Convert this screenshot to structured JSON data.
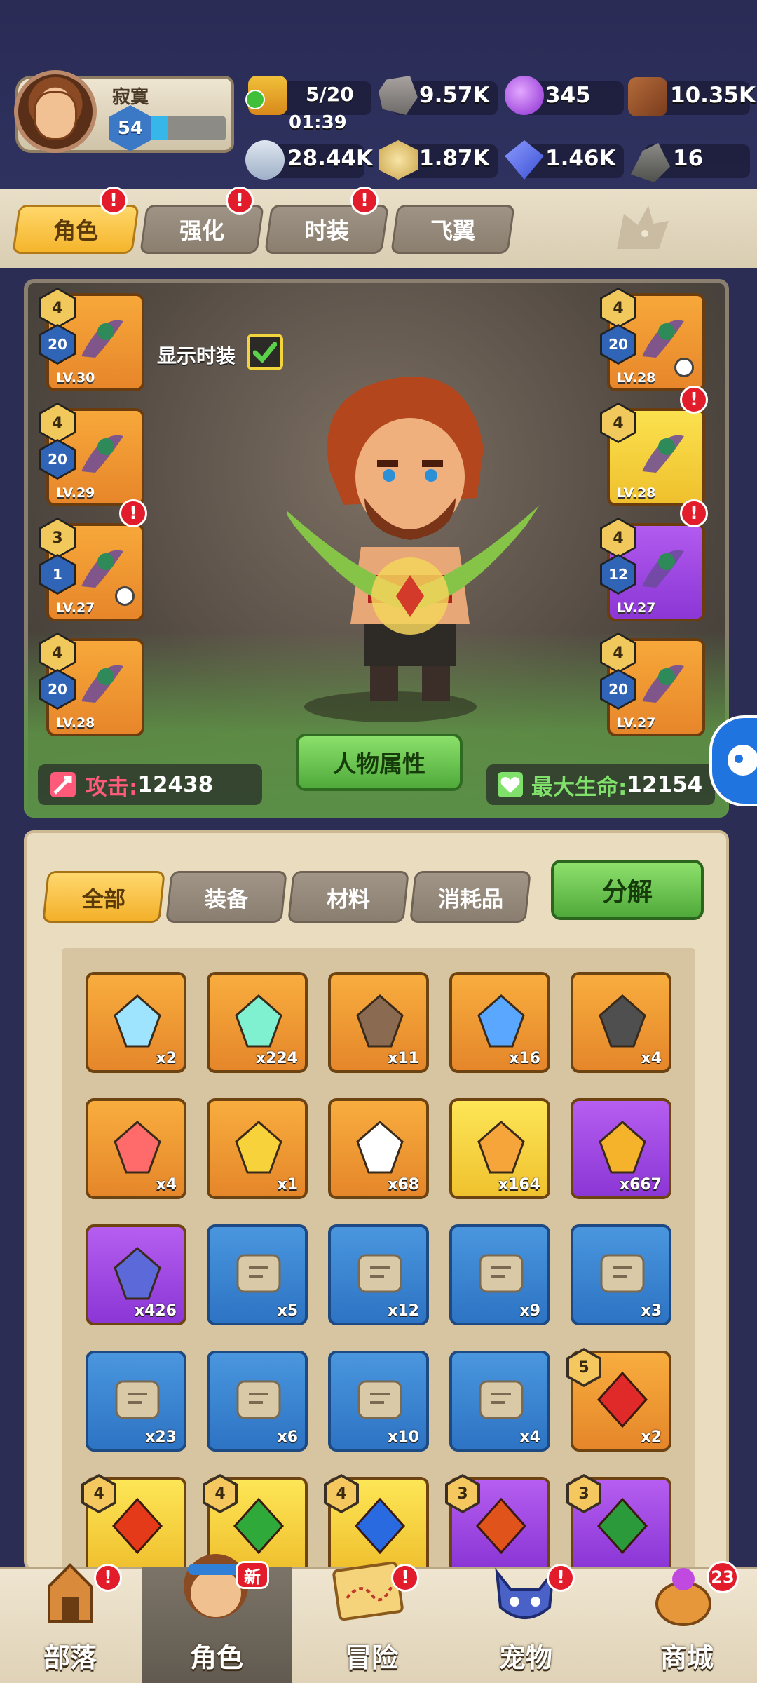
{
  "player": {
    "name": "寂寞",
    "level": "54",
    "xp_fraction": 0.26
  },
  "resources": {
    "stamina": "5/20",
    "stamina_timer": "01:39",
    "stone": "9.57K",
    "orb": "345",
    "wood": "10.35K",
    "bone": "28.44K",
    "coin": "1.87K",
    "crystal": "1.46K",
    "ore": "16"
  },
  "tabs": [
    "角色",
    "强化",
    "时装",
    "飞翼"
  ],
  "panel": {
    "show_fashion": "显示时装",
    "attack_label": "攻击:",
    "attack_value": "12438",
    "attr_button": "人物属性",
    "hp_label": "最大生命:",
    "hp_value": "12154"
  },
  "equip_left": [
    {
      "star": "4",
      "quality": "20",
      "lv": "LV.30"
    },
    {
      "star": "4",
      "quality": "20",
      "lv": "LV.29"
    },
    {
      "star": "3",
      "quality": "1",
      "lv": "LV.27"
    },
    {
      "star": "4",
      "quality": "20",
      "lv": "LV.28"
    }
  ],
  "equip_right": [
    {
      "star": "4",
      "quality": "20",
      "lv": "LV.28"
    },
    {
      "star": "4",
      "quality": "",
      "lv": "LV.28"
    },
    {
      "star": "4",
      "quality": "12",
      "lv": "LV.27"
    },
    {
      "star": "4",
      "quality": "20",
      "lv": "LV.27"
    }
  ],
  "filters": [
    "全部",
    "装备",
    "材料",
    "消耗品"
  ],
  "decompose": "分解",
  "items": [
    {
      "qty": "x2"
    },
    {
      "qty": "x224"
    },
    {
      "qty": "x11"
    },
    {
      "qty": "x16"
    },
    {
      "qty": "x4"
    },
    {
      "qty": "x4"
    },
    {
      "qty": "x1"
    },
    {
      "qty": "x68"
    },
    {
      "qty": "x164"
    },
    {
      "qty": "x667"
    },
    {
      "qty": "x426"
    },
    {
      "qty": "x5"
    },
    {
      "qty": "x12"
    },
    {
      "qty": "x9"
    },
    {
      "qty": "x3"
    },
    {
      "qty": "x23"
    },
    {
      "qty": "x6"
    },
    {
      "qty": "x10"
    },
    {
      "qty": "x4"
    },
    {
      "qty": "x2",
      "star": "5"
    },
    {
      "qty": "",
      "star": "4"
    },
    {
      "qty": "",
      "star": "4"
    },
    {
      "qty": "",
      "star": "4"
    },
    {
      "qty": "",
      "star": "3"
    },
    {
      "qty": "",
      "star": "3"
    }
  ],
  "nav": {
    "tribe": "部落",
    "character": "角色",
    "adventure": "冒险",
    "pet": "宠物",
    "shop": "商城",
    "new_badge": "新",
    "shop_count": "23"
  },
  "colors": {
    "alert": "#e21c2a",
    "accent_green": "#4faa3a",
    "accent_gold": "#f5b52c"
  }
}
